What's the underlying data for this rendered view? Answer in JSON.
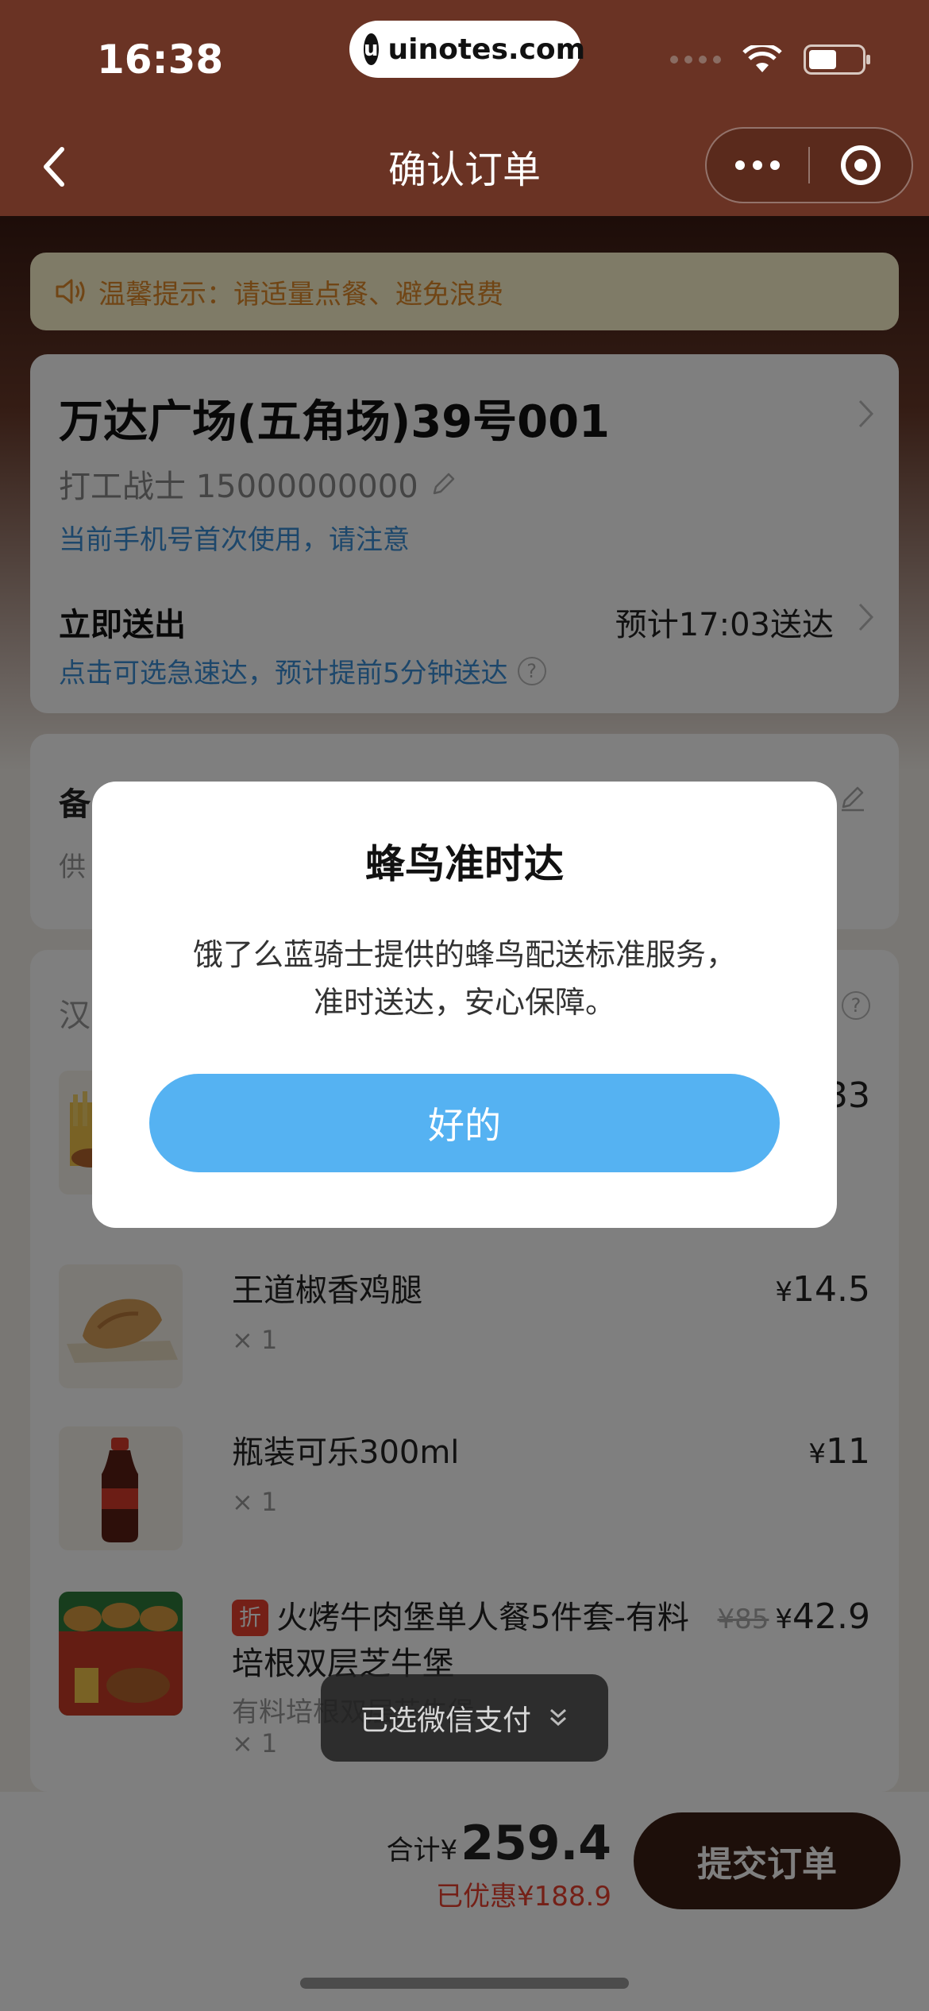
{
  "status_bar": {
    "time": "16:38",
    "url": "uinotes.com",
    "url_logo": "u"
  },
  "nav": {
    "title": "确认订单"
  },
  "tip": {
    "text": "温馨提示：请适量点餐、避免浪费"
  },
  "address": {
    "title": "万达广场(五角场)39号001",
    "contact": "打工战士 15000000000",
    "warning": "当前手机号首次使用，请注意"
  },
  "delivery": {
    "label": "立即送出",
    "eta": "预计17:03送达",
    "hint": "点击可选急速达，预计提前5分钟送达"
  },
  "remark": {
    "label": "备",
    "sub": "供"
  },
  "shop": {
    "name": "汉"
  },
  "items": [
    {
      "name": "",
      "qty": "",
      "price": "33"
    },
    {
      "name": "王道椒香鸡腿",
      "qty": "× 1",
      "price_yen": "¥",
      "price": "14.5"
    },
    {
      "name": "瓶装可乐300ml",
      "qty": "× 1",
      "price_yen": "¥",
      "price": "11"
    },
    {
      "tag": "折",
      "name": "火烤牛肉堡单人餐5件套-有料培根双层芝牛堡",
      "sub": "有料培根双层芝牛堡",
      "qty": "× 1",
      "old_price": "¥85",
      "price_yen": "¥",
      "price": "42.9"
    }
  ],
  "bottom": {
    "total_label": "合计¥",
    "total": "259.4",
    "saved": "已优惠¥188.9",
    "submit": "提交订单"
  },
  "toast": {
    "text": "已选微信支付"
  },
  "modal": {
    "title": "蜂鸟准时达",
    "line1": "饿了么蓝骑士提供的蜂鸟配送标准服务，",
    "line2": "准时送达，安心保障。",
    "button": "好的"
  },
  "colors": {
    "header_bg": "#6a3324",
    "link_blue": "#3b8fd6",
    "discount_red": "#e8402e",
    "modal_button": "#55b2f2",
    "submit_bg": "#3b1e14"
  }
}
